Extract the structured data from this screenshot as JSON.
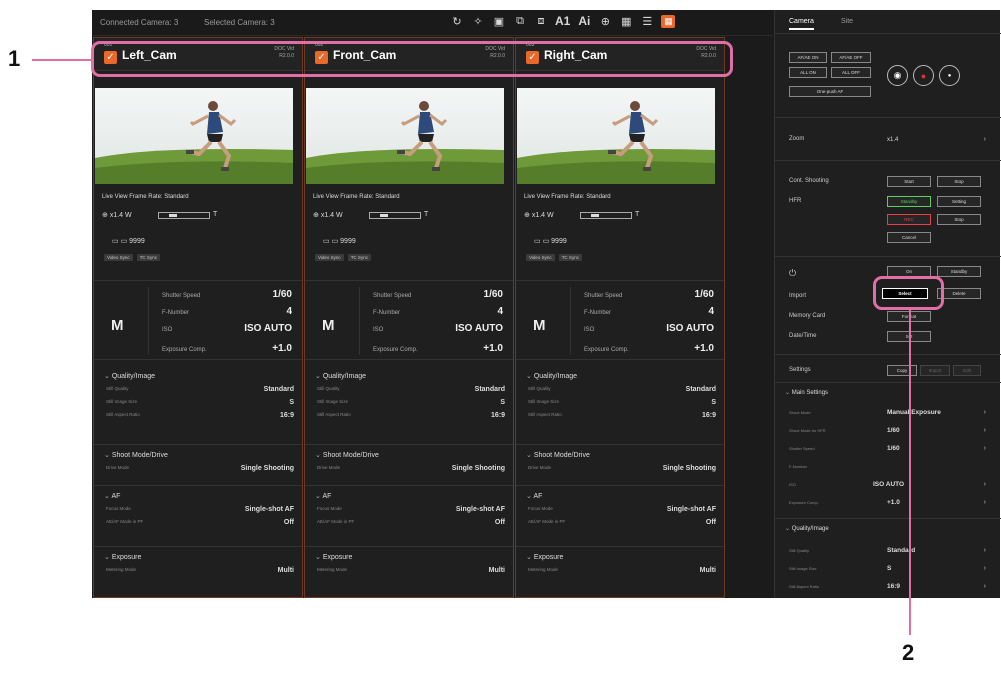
{
  "topbar": {
    "connected": "Connected Camera: 3",
    "selected": "Selected Camera: 3",
    "icons": [
      "refresh-icon",
      "focus-icon",
      "liveview-icon",
      "copy-icon",
      "layout-icon",
      "af-icon",
      "ai-icon",
      "zoom-icon",
      "grid-icon",
      "list-icon",
      "highlight-icon"
    ],
    "icon_glyphs": [
      "↻",
      "✧",
      "▣",
      "⧉",
      "⧈",
      "A1",
      "Ai",
      "⊕",
      "▦",
      "☰",
      "▦"
    ]
  },
  "cameras": [
    {
      "number": "001",
      "name": "Left_Cam",
      "badge_line1": "DOC Vid",
      "badge_line2": "R2.0.0",
      "frame_rate": "Live View Frame Rate: Standard",
      "zoom": "x1.4",
      "zoom_w": "W",
      "zoom_t": "T",
      "storage": "9999",
      "tags": [
        "Video Sync",
        "TC Sync"
      ],
      "mode": "M",
      "shutter_label": "Shutter Speed",
      "shutter": "1/60",
      "fnum_label": "F-Number",
      "fnum": "4",
      "iso_label": "ISO",
      "iso": "ISO AUTO",
      "ec_label": "Exposure Comp.",
      "ec": "+1.0",
      "quality_title": "Quality/Image",
      "q1_k": "Still Quality",
      "q1_v": "Standard",
      "q2_k": "Still Image Size",
      "q2_v": "S",
      "q3_k": "Still Aspect Ratio",
      "q3_v": "16:9",
      "drive_title": "Shoot Mode/Drive",
      "d1_k": "Drive Mode",
      "d1_v": "Single Shooting",
      "af_title": "AF",
      "a1_k": "Focus Mode",
      "a1_v": "Single-shot AF",
      "a2_k": "AE/AF Mode in PF",
      "a2_v": "Off",
      "exp_title": "Exposure",
      "x1_k": "Metering Mode",
      "x1_v": "Multi"
    },
    {
      "number": "002",
      "name": "Front_Cam",
      "badge_line1": "DOC Vid",
      "badge_line2": "R2.0.0",
      "frame_rate": "Live View Frame Rate: Standard",
      "zoom": "x1.4",
      "zoom_w": "W",
      "zoom_t": "T",
      "storage": "9999",
      "tags": [
        "Video Sync",
        "TC Sync"
      ],
      "mode": "M",
      "shutter_label": "Shutter Speed",
      "shutter": "1/60",
      "fnum_label": "F-Number",
      "fnum": "4",
      "iso_label": "ISO",
      "iso": "ISO AUTO",
      "ec_label": "Exposure Comp.",
      "ec": "+1.0",
      "quality_title": "Quality/Image",
      "q1_k": "Still Quality",
      "q1_v": "Standard",
      "q2_k": "Still Image Size",
      "q2_v": "S",
      "q3_k": "Still Aspect Ratio",
      "q3_v": "16:9",
      "drive_title": "Shoot Mode/Drive",
      "d1_k": "Drive Mode",
      "d1_v": "Single Shooting",
      "af_title": "AF",
      "a1_k": "Focus Mode",
      "a1_v": "Single-shot AF",
      "a2_k": "AE/AF Mode in PF",
      "a2_v": "Off",
      "exp_title": "Exposure",
      "x1_k": "Metering Mode",
      "x1_v": "Multi"
    },
    {
      "number": "003",
      "name": "Right_Cam",
      "badge_line1": "DOC Vid",
      "badge_line2": "R2.0.0",
      "frame_rate": "Live View Frame Rate: Standard",
      "zoom": "x1.4",
      "zoom_w": "W",
      "zoom_t": "T",
      "storage": "9999",
      "tags": [
        "Video Sync",
        "TC Sync"
      ],
      "mode": "M",
      "shutter_label": "Shutter Speed",
      "shutter": "1/60",
      "fnum_label": "F-Number",
      "fnum": "4",
      "iso_label": "ISO",
      "iso": "ISO AUTO",
      "ec_label": "Exposure Comp.",
      "ec": "+1.0",
      "quality_title": "Quality/Image",
      "q1_k": "Still Quality",
      "q1_v": "Standard",
      "q2_k": "Still Image Size",
      "q2_v": "S",
      "q3_k": "Still Aspect Ratio",
      "q3_v": "16:9",
      "drive_title": "Shoot Mode/Drive",
      "d1_k": "Drive Mode",
      "d1_v": "Single Shooting",
      "af_title": "AF",
      "a1_k": "Focus Mode",
      "a1_v": "Single-shot AF",
      "a2_k": "AE/AF Mode in PF",
      "a2_v": "Off",
      "exp_title": "Exposure",
      "x1_k": "Metering Mode",
      "x1_v": "Multi"
    }
  ],
  "panel": {
    "tab_camera": "Camera",
    "tab_site": "Site",
    "btn_afae_on": "AF/AE ON",
    "btn_afae_off": "AF/AE OFF",
    "btn_all_on": "ALL ON",
    "btn_all_off": "ALL OFF",
    "btn_one_push": "One-push AF",
    "zoom_label": "Zoom",
    "zoom_value": "x1.4",
    "cont_label": "Cont. Shooting",
    "cont_start": "Start",
    "cont_stop": "Stop",
    "hfr_label": "HFR",
    "hfr_standby": "Standby",
    "hfr_setting": "Setting",
    "hfr_rec": "REC",
    "hfr_stop": "Stop",
    "hfr_cancel": "Cancel",
    "power_on": "On",
    "power_standby": "Standby",
    "import_label": "Import",
    "import_select": "Select",
    "import_delete": "Delete",
    "memory_label": "Memory Card",
    "memory_btn": "Format",
    "date_label": "Date/Time",
    "date_btn": "Set",
    "settings_label": "Settings",
    "settings_copy": "Copy",
    "settings_import": "Import",
    "settings_edit": "Edit",
    "main_title": "Main Settings",
    "m1_k": "Shoot Mode",
    "m1_v": "Manual Exposure",
    "m2_k": "Shoot Mode for HFR",
    "m2_v": "1/60",
    "m3_k": "Shutter Speed",
    "m3_v": "1/60",
    "m4_k": "F-Number",
    "m4_v": "",
    "m5_k": "ISO",
    "m5_v": "ISO AUTO",
    "m6_k": "Exposure Comp.",
    "m6_v": "+1.0",
    "qual_title": "Quality/Image",
    "p1_k": "Still Quality",
    "p1_v": "Standard",
    "p2_k": "Still Image Size",
    "p2_v": "S",
    "p3_k": "Still Aspect Ratio",
    "p3_v": "16:9"
  },
  "callouts": {
    "n1": "1",
    "n2": "2"
  },
  "colors": {
    "accent": "#e8692a",
    "callout": "#e26ea6"
  }
}
